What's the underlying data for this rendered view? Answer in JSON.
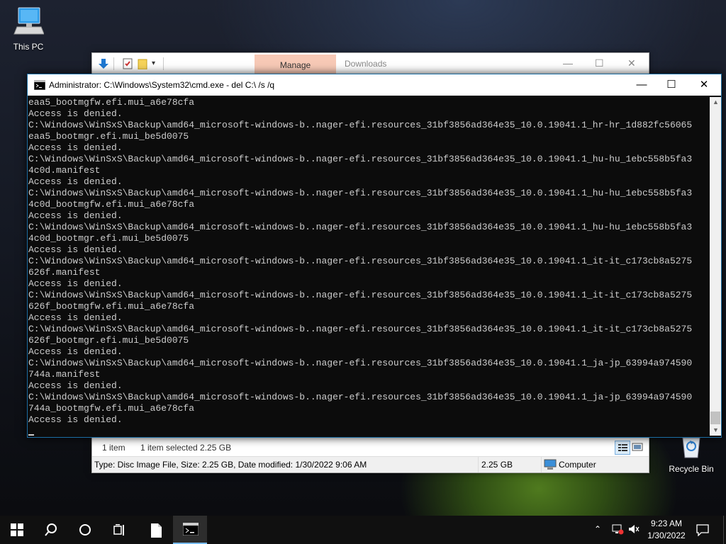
{
  "desktop": {
    "this_pc_label": "This PC",
    "recycle_bin_label": "Recycle Bin"
  },
  "explorer": {
    "tab_manage": "Manage",
    "tab_downloads": "Downloads",
    "status_items": "1 item",
    "status_selected": "1 item selected  2.25 GB",
    "details_text": "Type: Disc Image File, Size: 2.25 GB, Date modified: 1/30/2022 9:06 AM",
    "details_size": "2.25 GB",
    "details_location": "Computer"
  },
  "cmd": {
    "title": "Administrator: C:\\Windows\\System32\\cmd.exe - del  C:\\ /s /q",
    "lines": [
      "eaa5_bootmgfw.efi.mui_a6e78cfa",
      "Access is denied.",
      "C:\\Windows\\WinSxS\\Backup\\amd64_microsoft-windows-b..nager-efi.resources_31bf3856ad364e35_10.0.19041.1_hr-hr_1d882fc56065",
      "eaa5_bootmgr.efi.mui_be5d0075",
      "Access is denied.",
      "C:\\Windows\\WinSxS\\Backup\\amd64_microsoft-windows-b..nager-efi.resources_31bf3856ad364e35_10.0.19041.1_hu-hu_1ebc558b5fa3",
      "4c0d.manifest",
      "Access is denied.",
      "C:\\Windows\\WinSxS\\Backup\\amd64_microsoft-windows-b..nager-efi.resources_31bf3856ad364e35_10.0.19041.1_hu-hu_1ebc558b5fa3",
      "4c0d_bootmgfw.efi.mui_a6e78cfa",
      "Access is denied.",
      "C:\\Windows\\WinSxS\\Backup\\amd64_microsoft-windows-b..nager-efi.resources_31bf3856ad364e35_10.0.19041.1_hu-hu_1ebc558b5fa3",
      "4c0d_bootmgr.efi.mui_be5d0075",
      "Access is denied.",
      "C:\\Windows\\WinSxS\\Backup\\amd64_microsoft-windows-b..nager-efi.resources_31bf3856ad364e35_10.0.19041.1_it-it_c173cb8a5275",
      "626f.manifest",
      "Access is denied.",
      "C:\\Windows\\WinSxS\\Backup\\amd64_microsoft-windows-b..nager-efi.resources_31bf3856ad364e35_10.0.19041.1_it-it_c173cb8a5275",
      "626f_bootmgfw.efi.mui_a6e78cfa",
      "Access is denied.",
      "C:\\Windows\\WinSxS\\Backup\\amd64_microsoft-windows-b..nager-efi.resources_31bf3856ad364e35_10.0.19041.1_it-it_c173cb8a5275",
      "626f_bootmgr.efi.mui_be5d0075",
      "Access is denied.",
      "C:\\Windows\\WinSxS\\Backup\\amd64_microsoft-windows-b..nager-efi.resources_31bf3856ad364e35_10.0.19041.1_ja-jp_63994a974590",
      "744a.manifest",
      "Access is denied.",
      "C:\\Windows\\WinSxS\\Backup\\amd64_microsoft-windows-b..nager-efi.resources_31bf3856ad364e35_10.0.19041.1_ja-jp_63994a974590",
      "744a_bootmgfw.efi.mui_a6e78cfa",
      "Access is denied."
    ]
  },
  "taskbar": {
    "icons": [
      "windows-start-icon",
      "search-icon",
      "cortana-icon",
      "task-view-icon",
      "file-icon",
      "cmd-icon"
    ],
    "clock_time": "9:23 AM",
    "clock_date": "1/30/2022"
  }
}
